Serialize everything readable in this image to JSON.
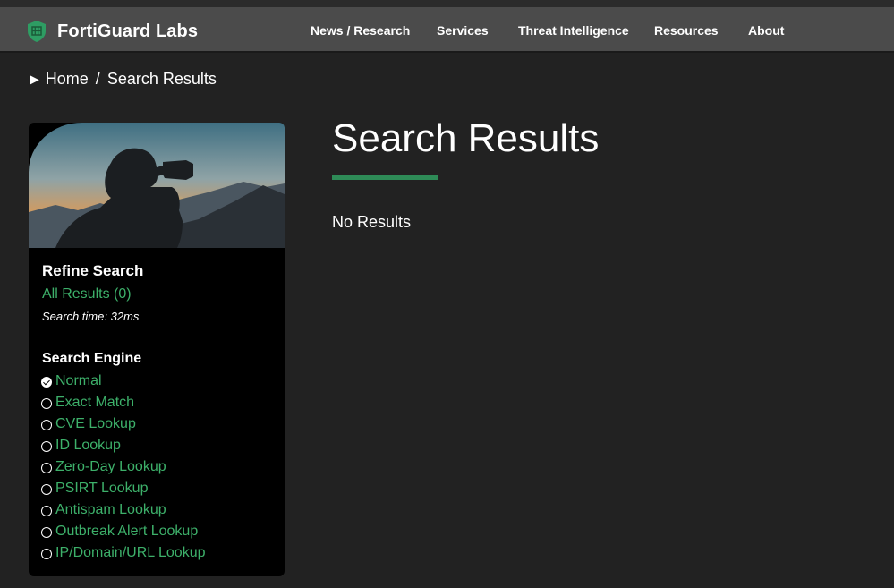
{
  "header": {
    "brand": "FortiGuard Labs",
    "nav": [
      {
        "label": "News / Research"
      },
      {
        "label": "Services"
      },
      {
        "label": "Threat Intelligence"
      },
      {
        "label": "Resources"
      },
      {
        "label": "About"
      }
    ]
  },
  "breadcrumb": {
    "home": "Home",
    "separator": "/",
    "current": "Search Results"
  },
  "sidebar": {
    "refine_title": "Refine Search",
    "all_results": "All Results (0)",
    "search_time": "Search time: 32ms",
    "engine_title": "Search Engine",
    "engines": [
      {
        "label": "Normal",
        "selected": true
      },
      {
        "label": "Exact Match",
        "selected": false
      },
      {
        "label": "CVE Lookup",
        "selected": false
      },
      {
        "label": "ID Lookup",
        "selected": false
      },
      {
        "label": "Zero-Day Lookup",
        "selected": false
      },
      {
        "label": "PSIRT Lookup",
        "selected": false
      },
      {
        "label": "Antispam Lookup",
        "selected": false
      },
      {
        "label": "Outbreak Alert Lookup",
        "selected": false
      },
      {
        "label": "IP/Domain/URL Lookup",
        "selected": false
      }
    ]
  },
  "main": {
    "title": "Search Results",
    "no_results": "No Results"
  },
  "colors": {
    "accent_green": "#3db06a",
    "underline_green": "#2e8b57",
    "nav_bg": "#4b4b4b",
    "page_bg": "#222222"
  }
}
